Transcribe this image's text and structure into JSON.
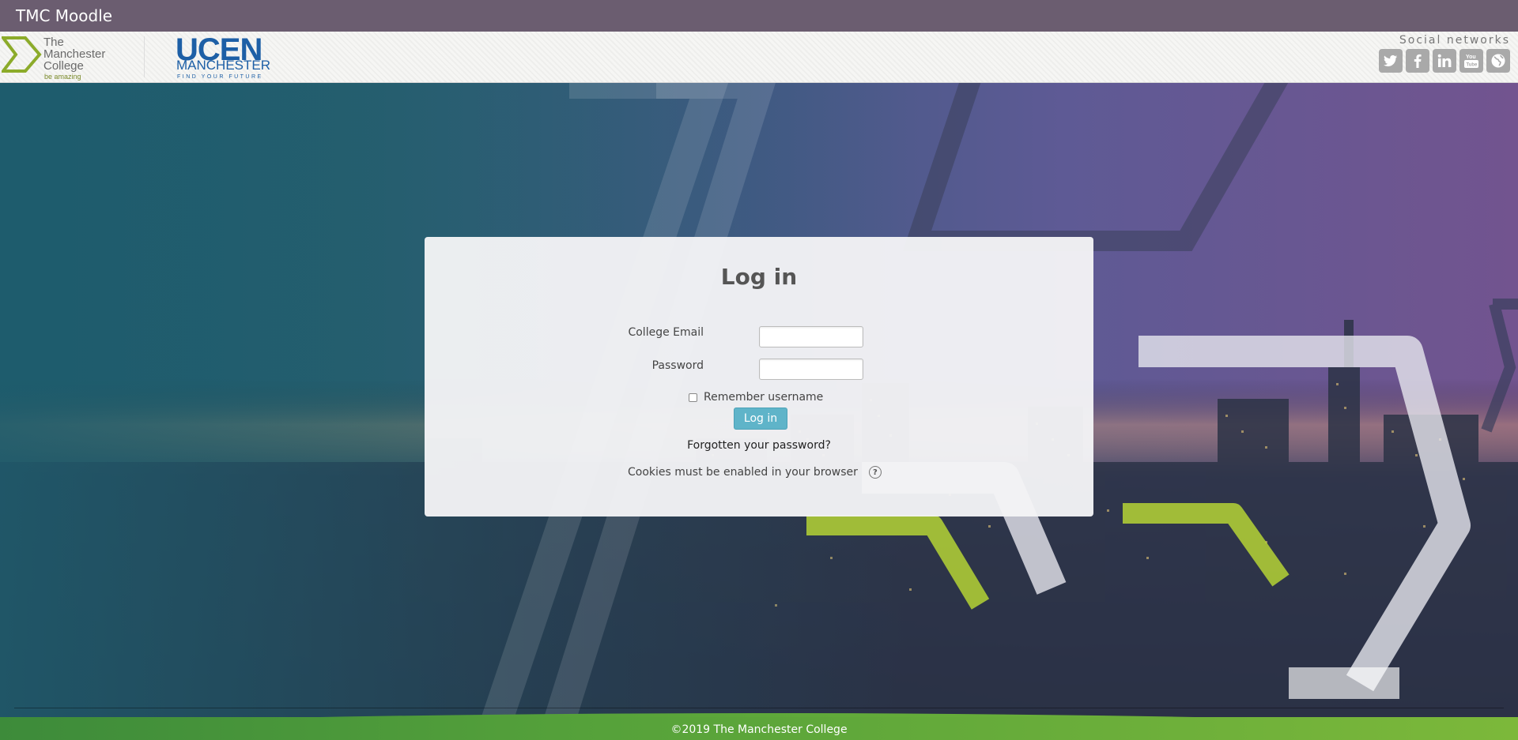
{
  "header": {
    "site_name": "TMC Moodle"
  },
  "brand": {
    "tmc_logo_lines": [
      "The",
      "Manchester",
      "College"
    ],
    "tmc_tagline": "be amazing",
    "ucen_main": "UCEN",
    "ucen_sub": "MANCHESTER",
    "ucen_tagline": "FIND YOUR FUTURE",
    "social_title": "Social networks",
    "social_icons": [
      "twitter-icon",
      "facebook-icon",
      "linkedin-icon",
      "youtube-icon",
      "globe-icon"
    ]
  },
  "login": {
    "title": "Log in",
    "email_label": "College Email",
    "email_value": "",
    "password_label": "Password",
    "password_value": "",
    "remember_label": "Remember username",
    "remember_checked": false,
    "submit_label": "Log in",
    "forgot_link": "Forgotten your password?",
    "cookies_notice": "Cookies must be enabled in your browser"
  },
  "footer": {
    "copyright": "©2019 The Manchester College"
  },
  "colors": {
    "topbar": "#6b5d70",
    "button": "#5fb4c9",
    "brand_blue": "#1d5fa6",
    "brand_green": "#7cb83a"
  }
}
